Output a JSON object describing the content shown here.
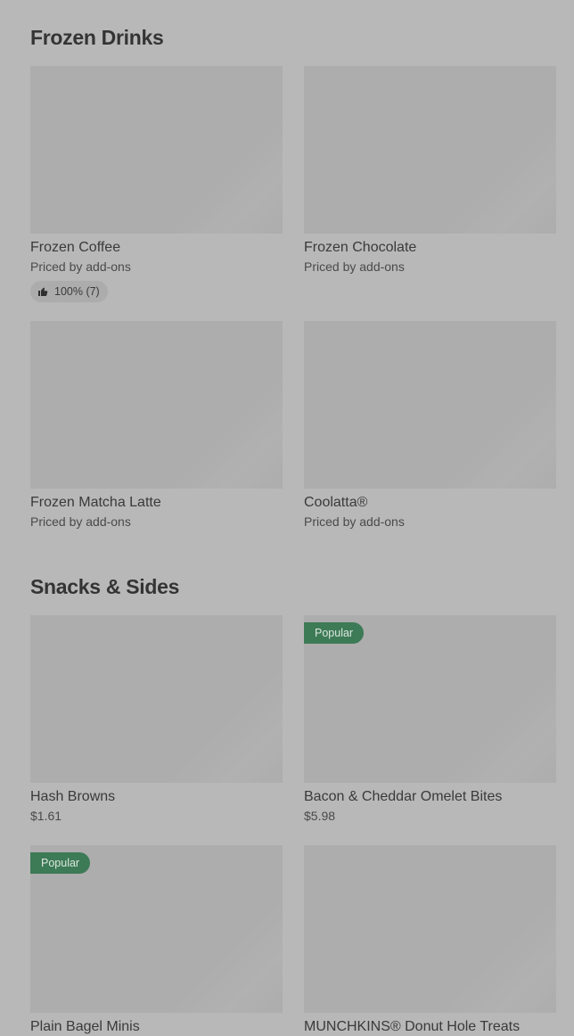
{
  "sections": [
    {
      "title": "Frozen Drinks",
      "items": [
        {
          "name": "Frozen Coffee",
          "price": "Priced by add-ons",
          "rating": "100% (7)"
        },
        {
          "name": "Frozen Chocolate",
          "price": "Priced by add-ons"
        },
        {
          "name": "Frozen Matcha Latte",
          "price": "Priced by add-ons"
        },
        {
          "name": "Coolatta®",
          "price": "Priced by add-ons"
        }
      ]
    },
    {
      "title": "Snacks & Sides",
      "items": [
        {
          "name": "Hash Browns",
          "price": "$1.61"
        },
        {
          "name": "Bacon & Cheddar Omelet Bites",
          "price": "$5.98",
          "badge": "Popular"
        },
        {
          "name": "Plain Bagel Minis",
          "badge": "Popular"
        },
        {
          "name": "MUNCHKINS® Donut Hole Treats"
        }
      ]
    }
  ],
  "colors": {
    "background": "#b8b8b8",
    "image_placeholder": "#adadad",
    "badge": "#3d7a56"
  },
  "icons": {
    "rating": "thumbs-up-icon"
  }
}
